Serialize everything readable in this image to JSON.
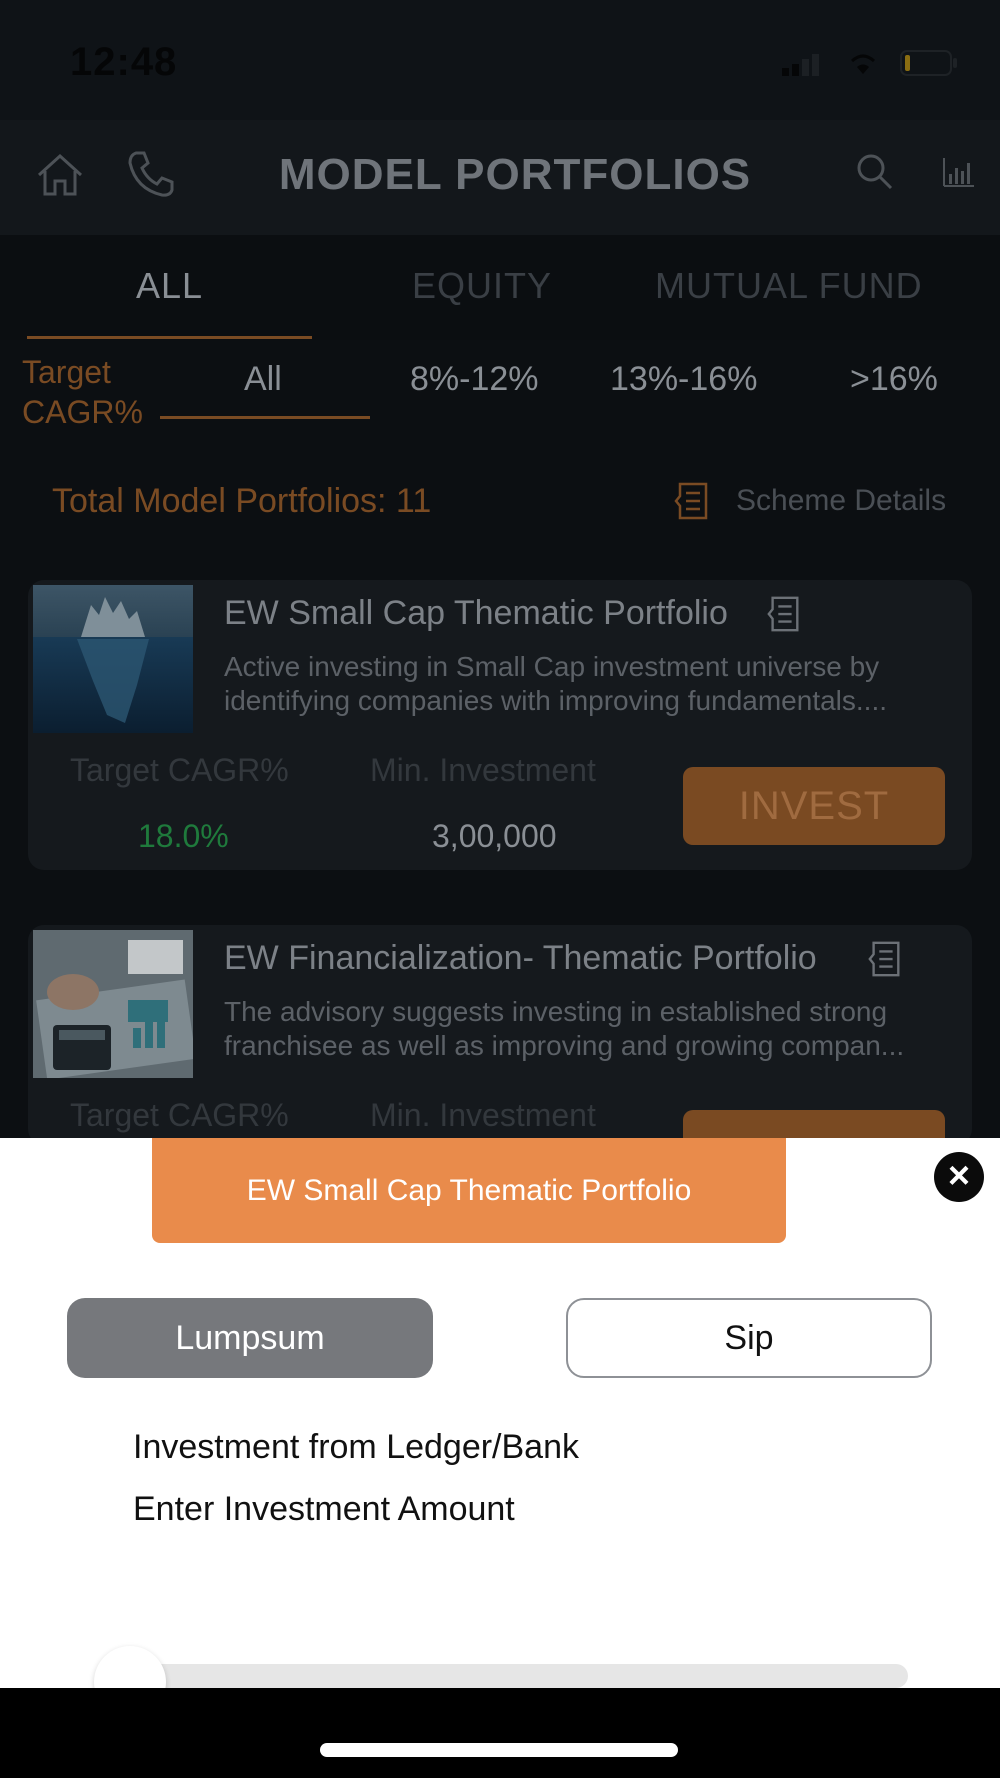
{
  "status_bar": {
    "time": "12:48"
  },
  "header": {
    "title": "MODEL PORTFOLIOS",
    "icons": [
      "home-icon",
      "phone-icon",
      "search-icon",
      "chart-icon"
    ]
  },
  "tabs": [
    {
      "label": "ALL",
      "active": true
    },
    {
      "label": "EQUITY",
      "active": false
    },
    {
      "label": "MUTUAL FUND",
      "active": false
    }
  ],
  "filter": {
    "label_line1": "Target",
    "label_line2": "CAGR%",
    "options": [
      "All",
      "8%-12%",
      "13%-16%",
      ">16%"
    ],
    "selected": "All"
  },
  "summary": {
    "total_text": "Total Model Portfolios: 11",
    "scheme_details": "Scheme Details"
  },
  "portfolios": [
    {
      "title": "EW Small Cap Thematic Portfolio",
      "description": "Active investing in Small Cap investment universe by identifying companies with improving fundamentals....",
      "target_label": "Target CAGR%",
      "target_value": "18.0%",
      "min_label": "Min. Investment",
      "min_value": "3,00,000",
      "button": "INVEST"
    },
    {
      "title": "EW Financialization- Thematic Portfolio",
      "description": "The advisory suggests investing in established strong franchisee as well as improving and growing compan...",
      "target_label": "Target CAGR%",
      "min_label": "Min. Investment"
    }
  ],
  "sheet": {
    "portfolio_name": "EW Small Cap Thematic Portfolio",
    "mode_options": [
      "Lumpsum",
      "Sip"
    ],
    "selected_mode": "Lumpsum",
    "line1": "Investment from Ledger/Bank",
    "line2": "Enter Investment Amount",
    "slider_level": 0
  },
  "colors": {
    "accent_orange": "#e98b4b",
    "positive_green": "#1f7a3c",
    "selected_mode_bg": "#76787c"
  }
}
